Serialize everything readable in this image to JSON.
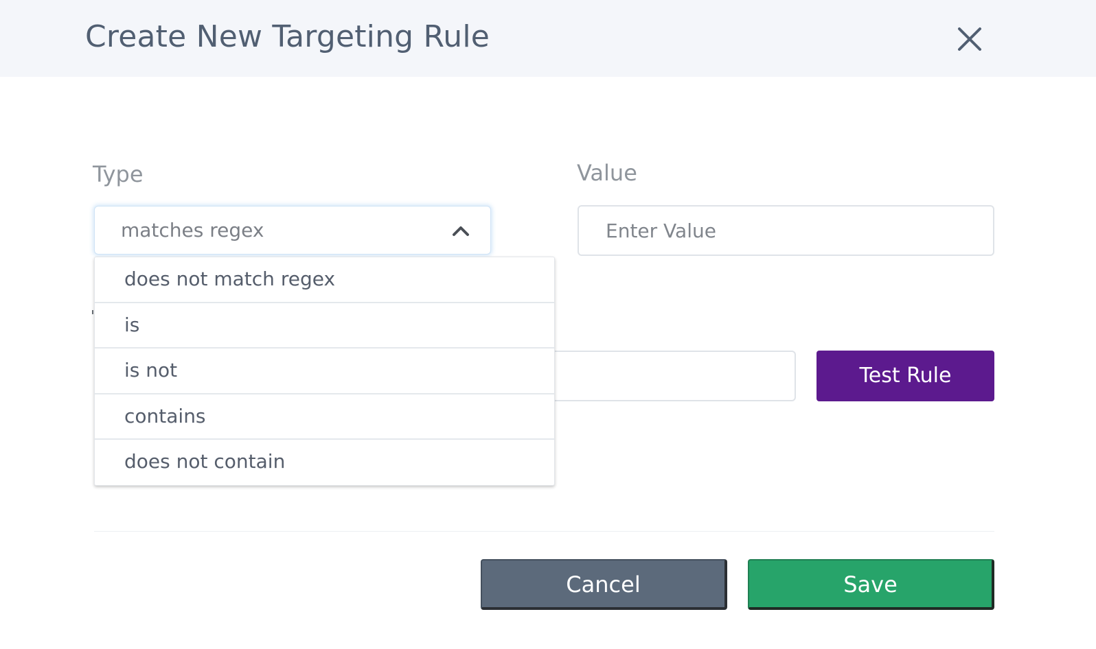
{
  "modal": {
    "title": "Create New Targeting Rule",
    "close_icon": "close-icon"
  },
  "form": {
    "type_label": "Type",
    "type_selected": "matches regex",
    "type_options": [
      "does not match regex",
      "is",
      "is not",
      "contains",
      "does not contain"
    ],
    "value_label": "Value",
    "value_placeholder": "Enter Value",
    "test_input_value": "",
    "test_button_label": "Test Rule"
  },
  "footer": {
    "cancel_label": "Cancel",
    "save_label": "Save"
  },
  "colors": {
    "header_bg": "#f4f6fa",
    "test_button": "#5c1a8e",
    "cancel_button": "#5c6a7b",
    "save_button": "#27a46a"
  }
}
